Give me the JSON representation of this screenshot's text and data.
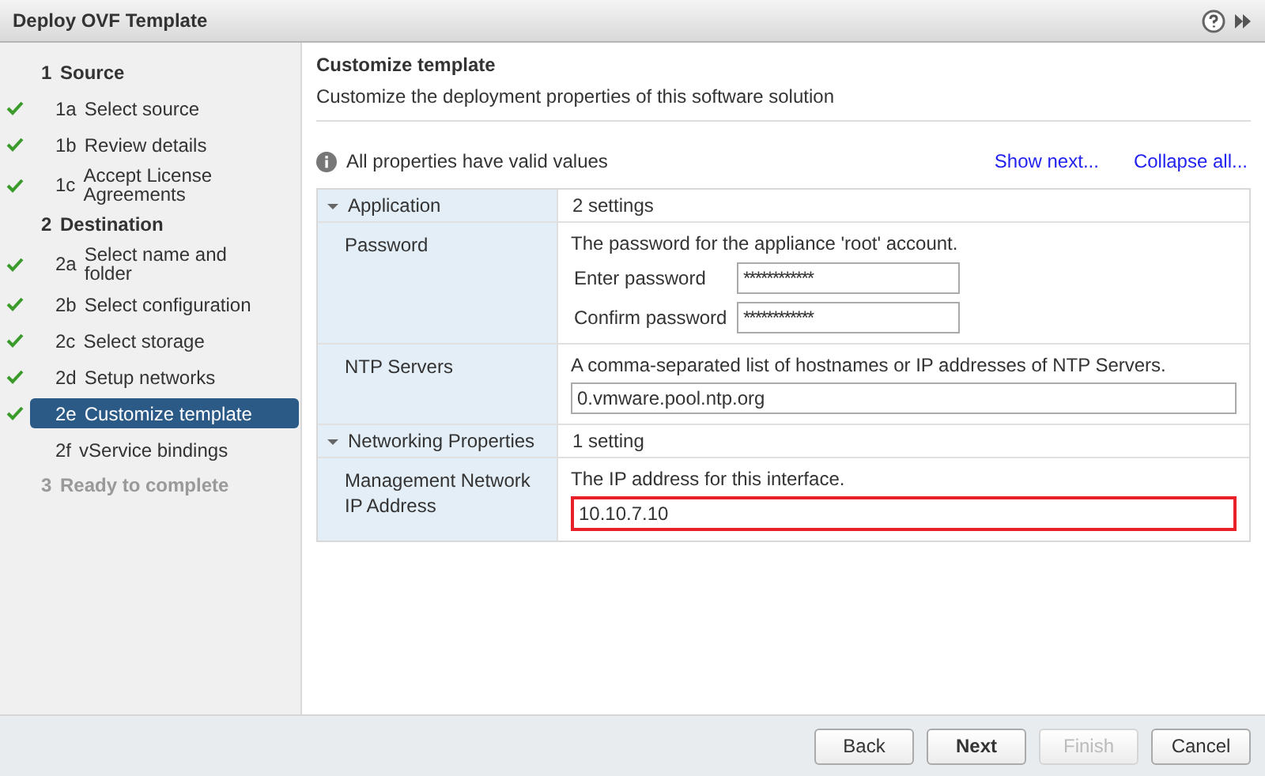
{
  "window": {
    "title": "Deploy OVF Template"
  },
  "steps": [
    {
      "kind": "group",
      "number": "1",
      "label": "Source",
      "disabled": false
    },
    {
      "kind": "step",
      "number": "1a",
      "label": "Select source",
      "done": true,
      "selected": false
    },
    {
      "kind": "step",
      "number": "1b",
      "label": "Review details",
      "done": true,
      "selected": false
    },
    {
      "kind": "step",
      "number": "1c",
      "label": "Accept License Agreements",
      "done": true,
      "selected": false
    },
    {
      "kind": "group",
      "number": "2",
      "label": "Destination",
      "disabled": false
    },
    {
      "kind": "step",
      "number": "2a",
      "label": "Select name and folder",
      "done": true,
      "selected": false
    },
    {
      "kind": "step",
      "number": "2b",
      "label": "Select configuration",
      "done": true,
      "selected": false
    },
    {
      "kind": "step",
      "number": "2c",
      "label": "Select storage",
      "done": true,
      "selected": false
    },
    {
      "kind": "step",
      "number": "2d",
      "label": "Setup networks",
      "done": true,
      "selected": false
    },
    {
      "kind": "step",
      "number": "2e",
      "label": "Customize template",
      "done": true,
      "selected": true
    },
    {
      "kind": "step",
      "number": "2f",
      "label": "vService bindings",
      "done": false,
      "selected": false
    },
    {
      "kind": "group",
      "number": "3",
      "label": "Ready to complete",
      "disabled": true
    }
  ],
  "page": {
    "title": "Customize template",
    "subtitle": "Customize the deployment properties of this software solution"
  },
  "status": "All properties have valid values",
  "links": [
    "Show next...",
    "Collapse all..."
  ],
  "sections": [
    {
      "title": "Application",
      "expanded": true,
      "summary": "2 settings",
      "properties": [
        {
          "label": "Password",
          "description": "The password for the appliance 'root' account.",
          "fields": [
            {
              "label": "Enter password",
              "value": "************",
              "highlighted": false
            },
            {
              "label": "Confirm password",
              "value": "************",
              "highlighted": false
            }
          ]
        },
        {
          "label": "NTP Servers",
          "description": "A comma-separated list of hostnames or IP addresses of NTP Servers.",
          "fields": [
            {
              "value": "0.vmware.pool.ntp.org",
              "highlighted": false
            }
          ]
        }
      ]
    },
    {
      "title": "Networking Properties",
      "expanded": true,
      "summary": "1 setting",
      "properties": [
        {
          "label": "Management Network IP Address",
          "description": "The IP address for this interface.",
          "fields": [
            {
              "value": "10.10.7.10",
              "highlighted": true
            }
          ]
        }
      ]
    }
  ],
  "buttons": [
    {
      "label": "Back",
      "primary": false,
      "disabled": false
    },
    {
      "label": "Next",
      "primary": true,
      "disabled": false
    },
    {
      "label": "Finish",
      "primary": false,
      "disabled": true
    },
    {
      "label": "Cancel",
      "primary": false,
      "disabled": false
    }
  ]
}
